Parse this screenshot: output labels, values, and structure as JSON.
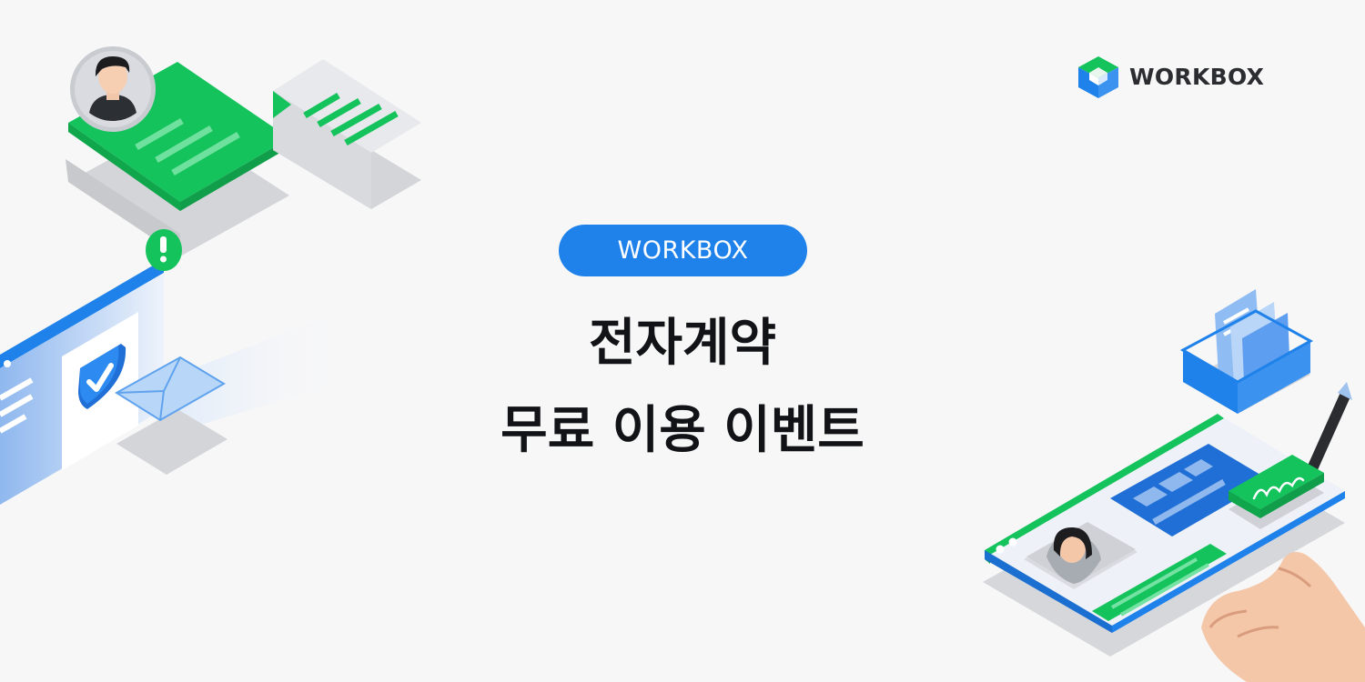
{
  "brand": {
    "name": "WORKBOX",
    "icon": "workbox-logo-icon",
    "colors": {
      "green": "#14c35b",
      "blue": "#1f82ea"
    }
  },
  "hero": {
    "badge": "WORKBOX",
    "title_line1": "전자계약",
    "title_line2": "무료 이용 이벤트"
  },
  "colors": {
    "background": "#f7f7f8",
    "accent_blue": "#1f82ea",
    "accent_green": "#14c35b",
    "headline": "#111316"
  },
  "illustrations": {
    "left": [
      "profile-card-icon",
      "document-icon",
      "alert-icon",
      "shield-check-icon",
      "envelope-icon"
    ],
    "right": [
      "file-tray-icon",
      "pen-icon",
      "signature-icon",
      "contract-window-icon",
      "hand-icon"
    ]
  }
}
